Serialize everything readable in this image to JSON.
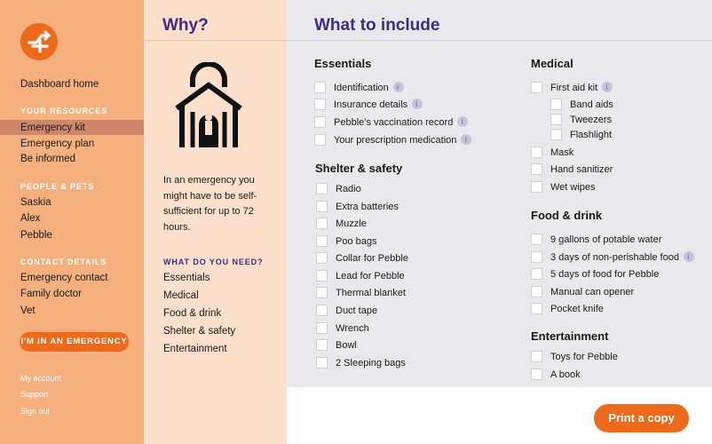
{
  "sidebar": {
    "dashboard": "Dashboard home",
    "resources_heading": "YOUR RESOURCES",
    "resources": [
      "Emergency kit",
      "Emergency plan",
      "Be informed"
    ],
    "people_heading": "PEOPLE & PETS",
    "people": [
      "Saskia",
      "Alex",
      "Pebble"
    ],
    "contacts_heading": "CONTACT DETAILS",
    "contacts": [
      "Emergency contact",
      "Family doctor",
      "Vet"
    ],
    "emergency_button": "I'M IN AN EMERGENCY",
    "footer_links": [
      "My account",
      "Support",
      "Sign out"
    ]
  },
  "why": {
    "title": "Why?",
    "text": "In an emergency you might have to be self-sufficient for up to 72 hours.",
    "need_title": "WHAT DO YOU NEED?",
    "needs": [
      "Essentials",
      "Medical",
      "Food & drink",
      "Shelter & safety",
      "Entertainment"
    ]
  },
  "main": {
    "title": "What to include",
    "print_button": "Print a copy",
    "essentials": {
      "title": "Essentials",
      "items": [
        "Identification",
        "Insurance details",
        "Pebble’s vaccination record",
        "Your prescription medication"
      ]
    },
    "shelter": {
      "title": "Shelter & safety",
      "items": [
        "Radio",
        "Extra batteries",
        "Muzzle",
        "Poo bags",
        "Collar for Pebble",
        "Lead for Pebble",
        "Thermal blanket",
        "Duct tape",
        "Wrench",
        "Bowl",
        "2 Sleeping bags"
      ]
    },
    "medical": {
      "title": "Medical",
      "items": [
        "First aid kit",
        "Band aids",
        "Tweezers",
        "Flashlight",
        "Mask",
        "Hand sanitizer",
        "Wet wipes"
      ]
    },
    "food": {
      "title": "Food & drink",
      "items": [
        "9 gallons of potable water",
        "3 days of non-perishable food",
        "5 days of food for Pebble",
        "Manual can opener",
        "Pocket knife"
      ]
    },
    "entertainment": {
      "title": "Entertainment",
      "items": [
        "Toys for Pebble",
        "A book"
      ]
    }
  },
  "colors": {
    "accent": "#ee6a1a",
    "purple": "#3f2a86",
    "sidebar": "#f5b07d",
    "why_panel": "#fbdfcb"
  }
}
